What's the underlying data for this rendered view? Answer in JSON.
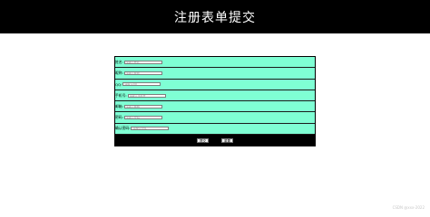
{
  "page": {
    "title": "注册表单提交"
  },
  "form": {
    "fields": [
      {
        "label": "姓名:",
        "placeholder": "请输入姓名"
      },
      {
        "label": "昵称:",
        "placeholder": "请输入昵称"
      },
      {
        "label": "QQ:",
        "placeholder": "请输入QQ"
      },
      {
        "label": "手机号:",
        "placeholder": "请输入手机号"
      },
      {
        "label": "邮箱:",
        "placeholder": "请输入邮箱"
      },
      {
        "label": "密码:",
        "placeholder": "请输入密码"
      },
      {
        "label": "确认密码:",
        "placeholder": "请确认密码"
      }
    ],
    "submit_label": "提交",
    "reset_label": "重置"
  },
  "watermark": "CSDN @xxx-2022",
  "colors": {
    "header_bg": "#000000",
    "row_bg": "#7fffd4",
    "actions_bg": "#000000"
  }
}
